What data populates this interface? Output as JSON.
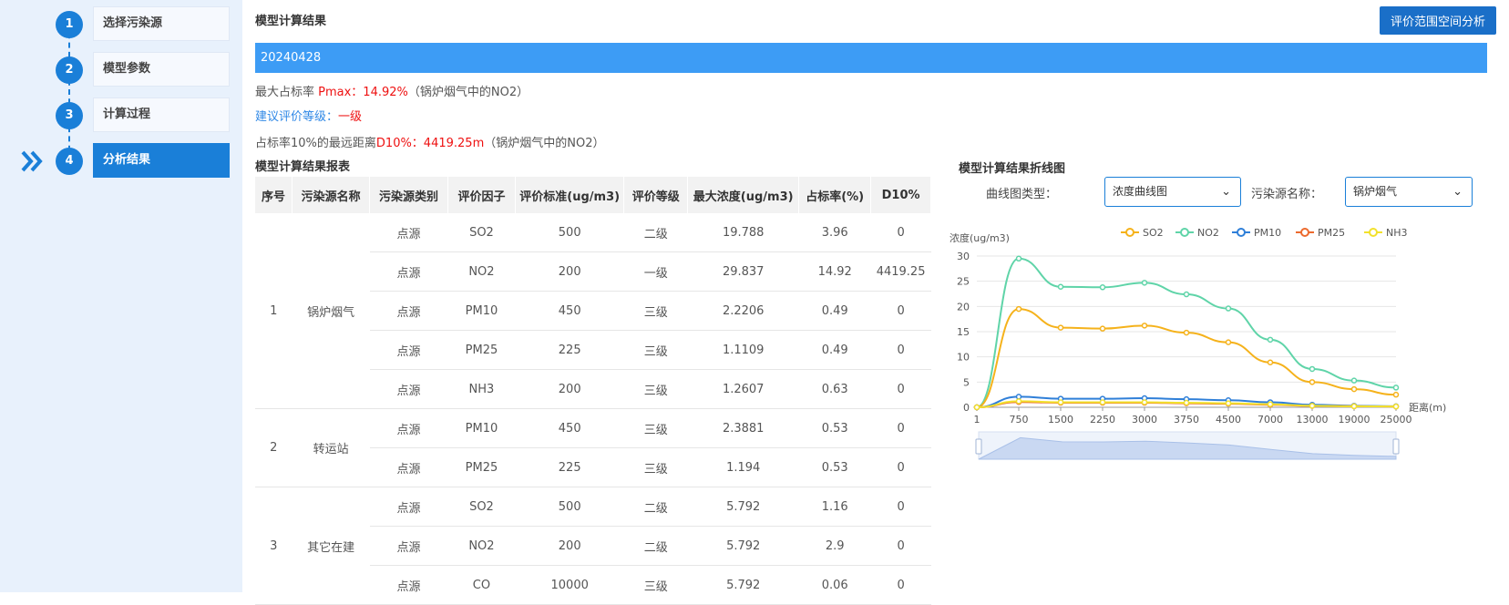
{
  "steps": [
    {
      "num": "1",
      "label": "选择污染源"
    },
    {
      "num": "2",
      "label": "模型参数"
    },
    {
      "num": "3",
      "label": "计算过程"
    },
    {
      "num": "4",
      "label": "分析结果"
    }
  ],
  "header": {
    "title": "模型计算结果",
    "button_label": "评价范围空间分析",
    "date": "20240428"
  },
  "summary": {
    "pmax_prefix": "最大占标率 ",
    "pmax_value": "Pmax：14.92%",
    "pmax_suffix": "（锅炉烟气中的NO2）",
    "level_prefix": "建议评价等级：",
    "level_value": "一级",
    "d10_prefix": "占标率10%的最远距离",
    "d10_value": "D10%：4419.25m",
    "d10_suffix": "（锅炉烟气中的NO2）"
  },
  "table": {
    "title": "模型计算结果报表",
    "headers": [
      "序号",
      "污染源名称",
      "污染源类别",
      "评价因子",
      "评价标准(ug/m3)",
      "评价等级",
      "最大浓度(ug/m3)",
      "占标率(%)",
      "D10%"
    ],
    "groups": [
      {
        "no": "1",
        "name": "锅炉烟气",
        "rows": [
          [
            "点源",
            "SO2",
            "500",
            "二级",
            "19.788",
            "3.96",
            "0"
          ],
          [
            "点源",
            "NO2",
            "200",
            "一级",
            "29.837",
            "14.92",
            "4419.25"
          ],
          [
            "点源",
            "PM10",
            "450",
            "三级",
            "2.2206",
            "0.49",
            "0"
          ],
          [
            "点源",
            "PM25",
            "225",
            "三级",
            "1.1109",
            "0.49",
            "0"
          ],
          [
            "点源",
            "NH3",
            "200",
            "三级",
            "1.2607",
            "0.63",
            "0"
          ]
        ]
      },
      {
        "no": "2",
        "name": "转运站",
        "rows": [
          [
            "点源",
            "PM10",
            "450",
            "三级",
            "2.3881",
            "0.53",
            "0"
          ],
          [
            "点源",
            "PM25",
            "225",
            "三级",
            "1.194",
            "0.53",
            "0"
          ]
        ]
      },
      {
        "no": "3",
        "name": "其它在建",
        "rows": [
          [
            "点源",
            "SO2",
            "500",
            "二级",
            "5.792",
            "1.16",
            "0"
          ],
          [
            "点源",
            "NO2",
            "200",
            "二级",
            "5.792",
            "2.9",
            "0"
          ],
          [
            "点源",
            "CO",
            "10000",
            "三级",
            "5.792",
            "0.06",
            "0"
          ]
        ]
      }
    ]
  },
  "chart_panel": {
    "title": "模型计算结果折线图",
    "curve_type_label": "曲线图类型：",
    "curve_type_value": "浓度曲线图",
    "source_label": "污染源名称：",
    "source_value": "锅炉烟气"
  },
  "chart_data": {
    "type": "line",
    "ylabel": "浓度(ug/m3)",
    "xlabel": "距离(m)",
    "ylim": [
      0,
      30
    ],
    "yticks": [
      "0",
      "5",
      "10",
      "15",
      "20",
      "25",
      "30"
    ],
    "x": [
      "1",
      "750",
      "1500",
      "2250",
      "3000",
      "3750",
      "4500",
      "7000",
      "13000",
      "19000",
      "25000"
    ],
    "grid": true,
    "legend_position": "top-right",
    "series": [
      {
        "name": "SO2",
        "color": "#f5b21b",
        "values": [
          0,
          19.5,
          15.8,
          15.6,
          16.2,
          14.8,
          12.9,
          8.9,
          5.0,
          3.6,
          2.5
        ]
      },
      {
        "name": "NO2",
        "color": "#5fd4a8",
        "values": [
          0,
          29.5,
          23.9,
          23.8,
          24.7,
          22.4,
          19.6,
          13.4,
          7.6,
          5.3,
          3.9
        ]
      },
      {
        "name": "PM10",
        "color": "#2f7fd8",
        "values": [
          0,
          2.1,
          1.7,
          1.7,
          1.8,
          1.6,
          1.4,
          1.0,
          0.5,
          0.3,
          0.2
        ]
      },
      {
        "name": "PM25",
        "color": "#ec6a2e",
        "values": [
          0,
          1.05,
          0.9,
          0.9,
          0.9,
          0.8,
          0.7,
          0.5,
          0.28,
          0.2,
          0.15
        ]
      },
      {
        "name": "NH3",
        "color": "#f2e12c",
        "values": [
          0,
          1.2,
          1.0,
          1.0,
          1.0,
          0.9,
          0.8,
          0.6,
          0.3,
          0.2,
          0.15
        ]
      }
    ]
  }
}
